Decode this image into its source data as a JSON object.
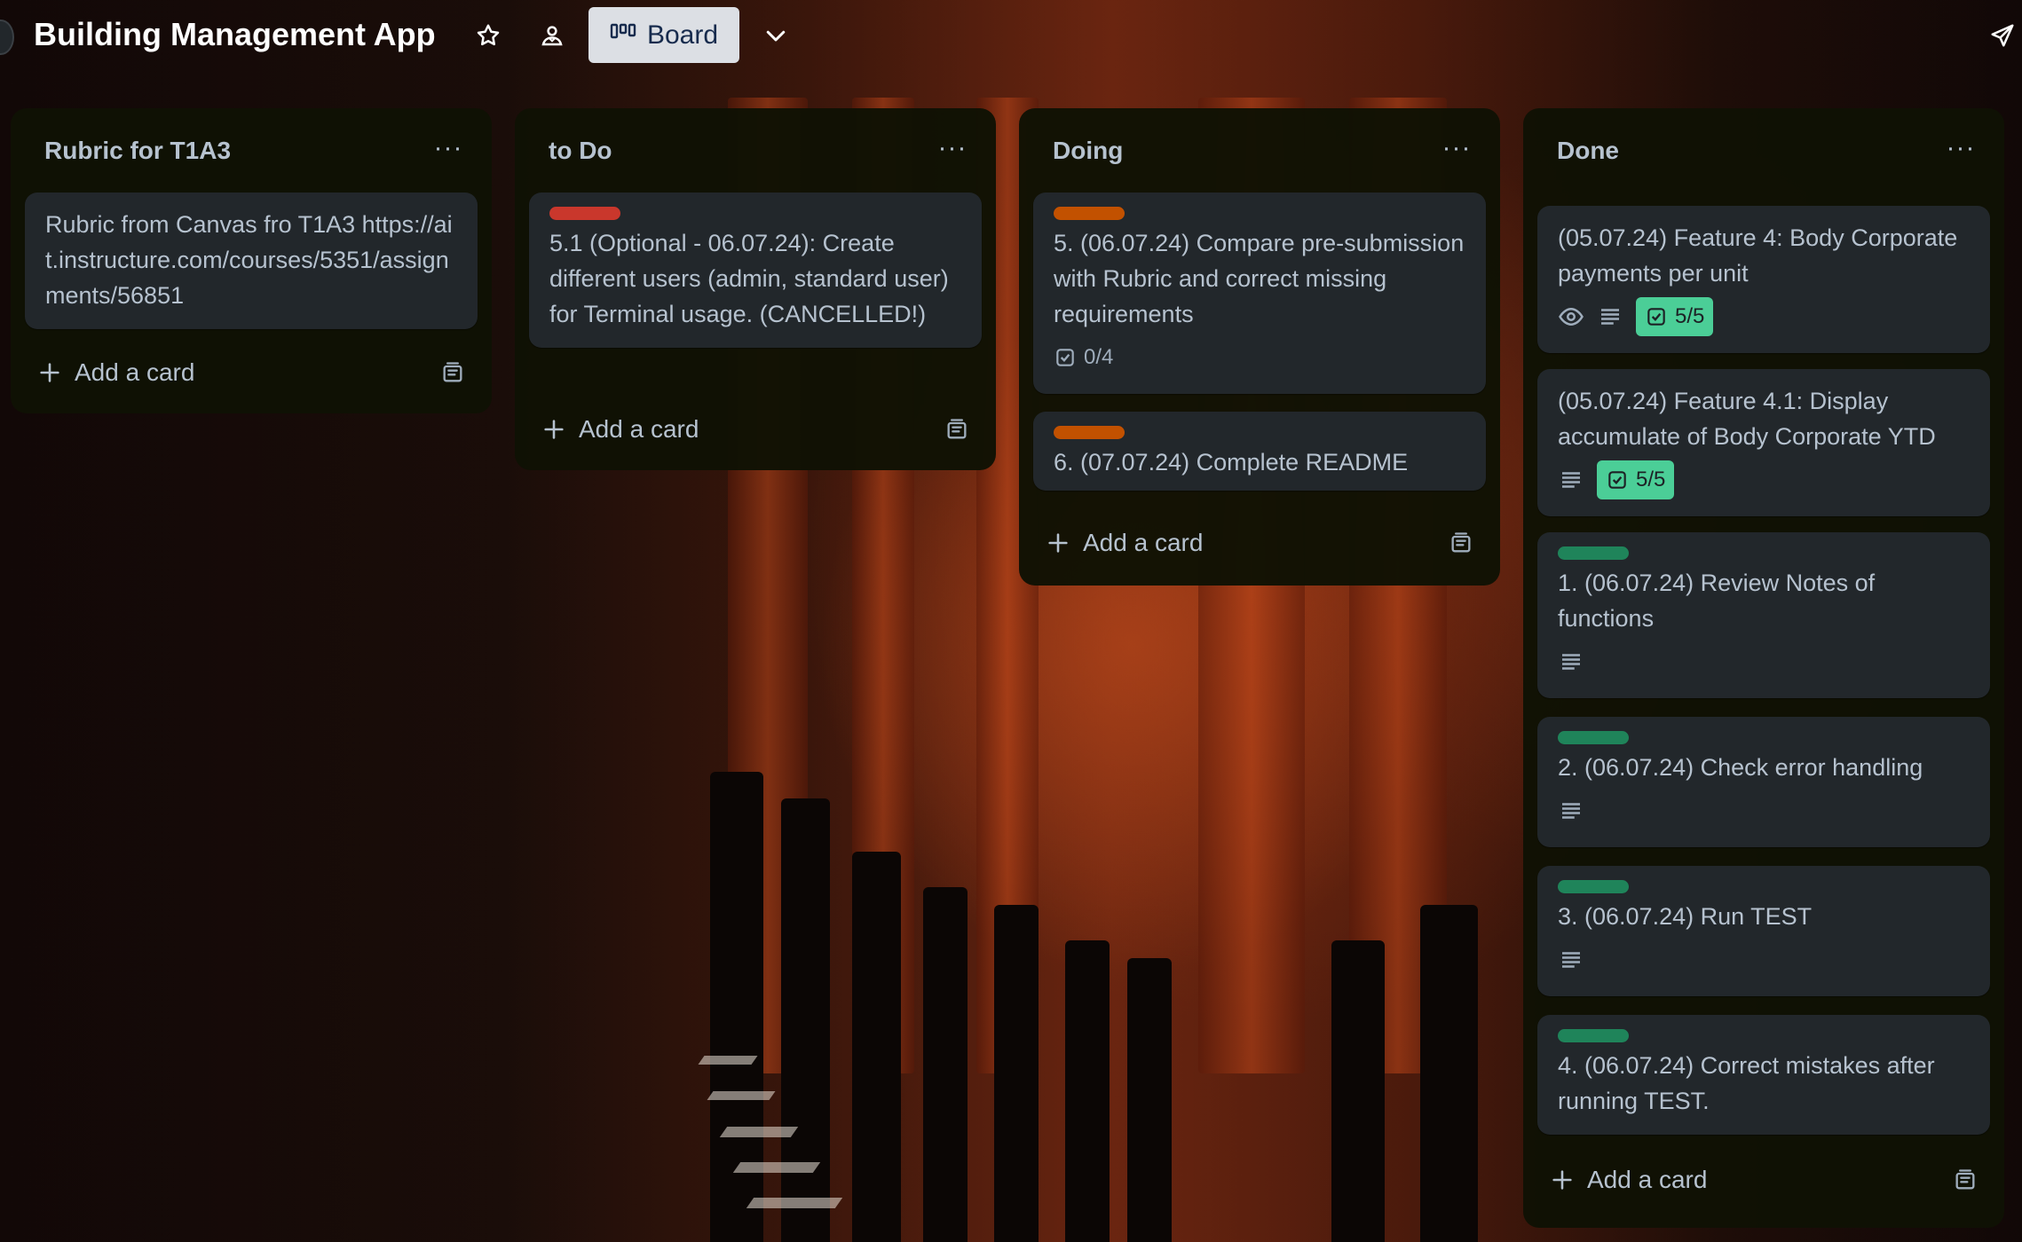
{
  "colors": {
    "label_red": "#c9372c",
    "label_orange": "#c25100",
    "label_green": "#1f845a",
    "checklist_complete": "#4bce97"
  },
  "header": {
    "board_title": "Building Management App",
    "star_icon": "star-icon",
    "workspace_icon": "workspace-visibility-icon",
    "view_label": "Board",
    "view_icon": "board-view-icon",
    "views_dropdown_icon": "chevron-down-icon",
    "share_icon": "paper-plane-icon"
  },
  "lists": [
    {
      "title": "Rubric for T1A3",
      "cards": [
        {
          "text": "Rubric from Canvas fro T1A3 https://ait.instructure.com/courses/5351/assignments/56851"
        }
      ],
      "add_card_label": "Add a card"
    },
    {
      "title": "to Do",
      "cards": [
        {
          "label": "red",
          "text": "5.1 (Optional - 06.07.24): Create different users (admin, standard user) for Terminal usage. (CANCELLED!)"
        }
      ],
      "add_card_label": "Add a card"
    },
    {
      "title": "Doing",
      "cards": [
        {
          "label": "orange",
          "text": "5. (06.07.24) Compare pre-submission with Rubric and correct missing requirements",
          "checklist": "0/4"
        },
        {
          "label": "orange",
          "text": "6. (07.07.24) Complete README"
        }
      ],
      "add_card_label": "Add a card"
    },
    {
      "title": "Done",
      "cards": [
        {
          "text": "(05.07.24) Feature 4: Body Corporate payments per unit",
          "watching": true,
          "description": true,
          "checklist": "5/5"
        },
        {
          "text": "(05.07.24) Feature 4.1: Display accumulate of Body Corporate YTD",
          "description": true,
          "checklist": "5/5"
        },
        {
          "label": "green",
          "text": "1. (06.07.24) Review Notes of functions",
          "description": true
        },
        {
          "label": "green",
          "text": "2. (06.07.24) Check error handling",
          "description": true
        },
        {
          "label": "green",
          "text": "3. (06.07.24) Run TEST",
          "description": true
        },
        {
          "label": "green",
          "text": "4. (06.07.24) Correct mistakes after running TEST."
        }
      ],
      "add_card_label": "Add a card"
    }
  ]
}
